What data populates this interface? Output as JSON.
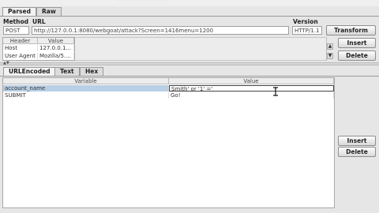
{
  "window": {
    "title_fragment": "- - - - - - - - - - - -"
  },
  "tabs": {
    "parsed": "Parsed",
    "raw": "Raw"
  },
  "request": {
    "method_label": "Method",
    "url_label": "URL",
    "version_label": "Version",
    "method": "POST",
    "url": "http://127.0.0.1:8080/webgoat/attack?Screen=1416menu=1200",
    "version": "HTTP/1.1",
    "transform_label": "Transform"
  },
  "headers": {
    "columns": [
      "Header",
      "Value"
    ],
    "rows": [
      {
        "header": "Host",
        "value": "127.0.0.1..."
      },
      {
        "header": "User Agent",
        "value": "Mozilla/5...."
      }
    ],
    "insert_label": "Insert",
    "delete_label": "Delete"
  },
  "body_tabs": {
    "urlencoded": "URLEncoded",
    "text": "Text",
    "hex": "Hex"
  },
  "params": {
    "columns": [
      "Variable",
      "Value"
    ],
    "rows": [
      {
        "variable": "account_name",
        "value": "Smith' or '1' ='"
      },
      {
        "variable": "SUBMIT",
        "value": "Go!"
      }
    ],
    "insert_label": "Insert",
    "delete_label": "Delete"
  },
  "colors": {
    "selected_row": "#b8cfe5",
    "accent": "#e06666"
  }
}
